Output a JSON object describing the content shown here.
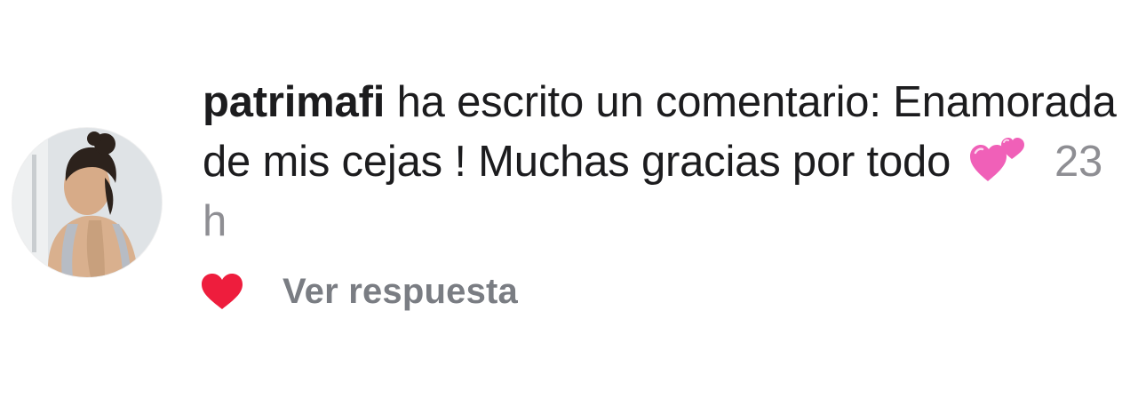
{
  "comment": {
    "username": "patrimafi",
    "intro": "ha escrito un comentario:",
    "text": "Enamorada de mis cejas ! Muchas gracias por todo",
    "emoji_icon": "two-hearts-icon",
    "time": "23 h"
  },
  "avatar": {
    "icon": "profile-photo"
  },
  "actions": {
    "like_icon": "heart-filled-icon",
    "reply_label": "Ver respuesta"
  },
  "colors": {
    "text": "#1c1c1e",
    "muted": "#8e8e93",
    "like_red": "#ee1d3d",
    "hearts_pink": "#f25fb8"
  }
}
